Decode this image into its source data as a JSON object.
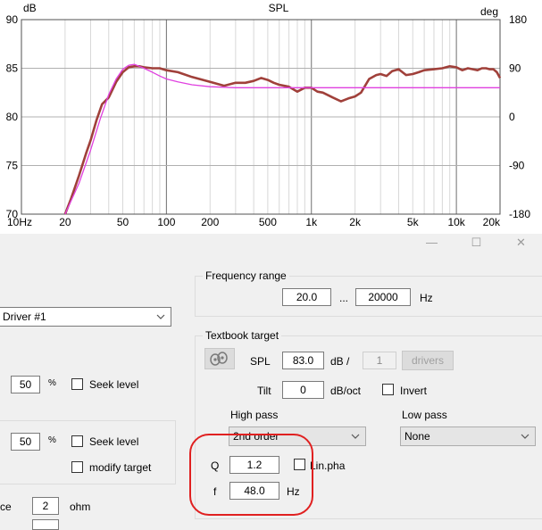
{
  "chart_data": {
    "type": "line",
    "title": "SPL",
    "ylabel": "dB",
    "ylabel_right": "deg",
    "x_scale": "log",
    "xlim": [
      10,
      20000
    ],
    "ylim": [
      70,
      90
    ],
    "ylim_right": [
      -180,
      180
    ],
    "x_ticks": [
      {
        "value": 10,
        "label": "10Hz"
      },
      {
        "value": 20,
        "label": "20"
      },
      {
        "value": 50,
        "label": "50"
      },
      {
        "value": 100,
        "label": "100"
      },
      {
        "value": 200,
        "label": "200"
      },
      {
        "value": 500,
        "label": "500"
      },
      {
        "value": 1000,
        "label": "1k"
      },
      {
        "value": 2000,
        "label": "2k"
      },
      {
        "value": 5000,
        "label": "5k"
      },
      {
        "value": 10000,
        "label": "10k"
      },
      {
        "value": 20000,
        "label": "20k"
      }
    ],
    "y_ticks": [
      70,
      75,
      80,
      85,
      90
    ],
    "y_ticks_right": [
      -180,
      -90,
      0,
      90,
      180
    ],
    "grid": true,
    "series": [
      {
        "color": "#a0403a",
        "x": [
          20,
          22,
          25,
          28,
          30,
          33,
          36,
          40,
          45,
          50,
          55,
          60,
          65,
          70,
          80,
          90,
          100,
          120,
          150,
          200,
          250,
          300,
          350,
          400,
          450,
          500,
          550,
          600,
          700,
          800,
          900,
          1000,
          1100,
          1200,
          1400,
          1600,
          1800,
          2000,
          2200,
          2500,
          2800,
          3000,
          3300,
          3600,
          4000,
          4500,
          5000,
          5500,
          6000,
          7000,
          8000,
          9000,
          10000,
          11000,
          12000,
          13000,
          14000,
          15000,
          16000,
          17000,
          18000,
          19000,
          20000
        ],
        "y": [
          70.0,
          71.6,
          74.0,
          76.3,
          77.6,
          79.7,
          81.3,
          82.0,
          83.6,
          84.6,
          85.1,
          85.2,
          85.2,
          85.1,
          85.0,
          85.0,
          84.8,
          84.6,
          84.1,
          83.6,
          83.2,
          83.5,
          83.5,
          83.7,
          84.0,
          83.8,
          83.5,
          83.3,
          83.1,
          82.6,
          83.0,
          83.0,
          82.6,
          82.5,
          82.0,
          81.6,
          81.9,
          82.1,
          82.5,
          83.9,
          84.3,
          84.4,
          84.2,
          84.7,
          84.9,
          84.3,
          84.4,
          84.6,
          84.8,
          84.9,
          85.0,
          85.2,
          85.1,
          84.8,
          85.0,
          84.9,
          84.8,
          85.0,
          85.0,
          84.9,
          84.9,
          84.6,
          84.0
        ]
      },
      {
        "color": "#e040e0",
        "x": [
          20,
          25,
          30,
          35,
          40,
          45,
          50,
          55,
          60,
          65,
          70,
          80,
          90,
          100,
          120,
          150,
          200,
          300,
          500,
          1000,
          2000,
          5000,
          10000,
          20000
        ],
        "y": [
          70.0,
          73.2,
          76.6,
          79.8,
          82.3,
          83.9,
          84.9,
          85.3,
          85.4,
          85.2,
          85.0,
          84.6,
          84.2,
          83.9,
          83.6,
          83.3,
          83.1,
          83.0,
          83.0,
          83.0,
          83.0,
          83.0,
          83.0,
          83.0
        ]
      }
    ]
  },
  "form": {
    "frequency_range": {
      "title": "Frequency range",
      "low": "20.0",
      "separator": "...",
      "high": "20000",
      "unit": "Hz"
    },
    "driver_select": {
      "value": "Driver #1"
    },
    "left": {
      "percent1": "50",
      "percent_sign1": "%",
      "seek_level1": "Seek level",
      "percent2": "50",
      "percent_sign2": "%",
      "seek_level2": "Seek level",
      "modify_target": "modify target",
      "impedance_label": "ce",
      "impedance_value": "2",
      "impedance_unit": "ohm"
    },
    "textbook_target": {
      "title": "Textbook target",
      "spl_label": "SPL",
      "spl_value": "83.0",
      "spl_unit": "dB /",
      "drivers_count": "1",
      "drivers_button": "drivers",
      "tilt_label": "Tilt",
      "tilt_value": "0",
      "tilt_unit": "dB/oct",
      "invert_label": "Invert",
      "high_pass_label": "High pass",
      "high_pass_value": "2nd order",
      "low_pass_label": "Low pass",
      "low_pass_value": "None",
      "q_label": "Q",
      "q_value": "1.2",
      "lin_pha_label": "Lin.pha",
      "f_label": "f",
      "f_value": "48.0",
      "f_unit": "Hz"
    }
  },
  "colors": {
    "measured": "#a0403a",
    "target": "#e040e0",
    "highlight": "#e02020"
  }
}
